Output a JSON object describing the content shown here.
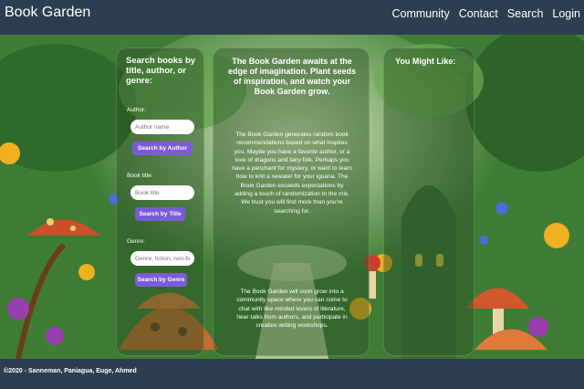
{
  "navbar": {
    "brand": "Book Garden",
    "links": [
      "Community",
      "Contact",
      "Search",
      "Login"
    ]
  },
  "search_panel": {
    "title": "Search books by title, author, or genre:",
    "author": {
      "label": "Author:",
      "placeholder": "Author name",
      "button": "Search by Author"
    },
    "title_field": {
      "label": "Book title:",
      "placeholder": "Book title",
      "button": "Search by Title"
    },
    "genre": {
      "label": "Genre:",
      "placeholder": "Genre, fiction, non-fiction",
      "button": "Search by Genre"
    }
  },
  "intro_panel": {
    "heading": "The Book Garden awaits at the edge of imagination. Plant seeds of inspiration, and watch your Book Garden grow.",
    "paragraph1": "The Book Garden generates random book recommendations based on what inspires you. Maybe you have a favorite author, or a love of dragons and fairy folk. Perhaps you have a penchant for mystery, or want to learn how to knit a sweater for your iguana. The Book Garden exceeds expectations by adding a touch of randomization to the mix. We trust you will find more than you're searching for.",
    "paragraph2": "The Book Garden will soon grow into a community space where you can come to chat with like minded lovers of literature, hear talks from authors, and participate in creative writing workshops."
  },
  "suggest_panel": {
    "title": "You Might Like:"
  },
  "footer": {
    "text": "©2020 - Sanneman, Paniagua, Euge, Ahmed"
  }
}
